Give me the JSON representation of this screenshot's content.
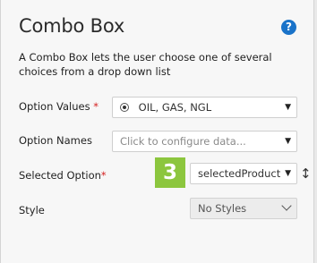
{
  "panel": {
    "title": "Combo Box",
    "help_icon": "?",
    "description": "A Combo Box lets the user choose one of several choices from a drop down list"
  },
  "fields": {
    "option_values": {
      "label": "Option Values",
      "required_mark": "*",
      "value": "OIL, GAS, NGL",
      "caret": "▼"
    },
    "option_names": {
      "label": "Option Names",
      "placeholder": "Click to configure data...",
      "caret": "▼"
    },
    "selected_option": {
      "label": "Selected Option",
      "required_mark": "*",
      "value": "selectedProduct",
      "caret": "▼",
      "step_badge": "3",
      "resize_glyph": "↕"
    },
    "style": {
      "label": "Style",
      "value": "No Styles"
    }
  },
  "colors": {
    "help_icon": "#1a73c9",
    "required": "#d42020",
    "step_badge": "#8cc63e"
  }
}
